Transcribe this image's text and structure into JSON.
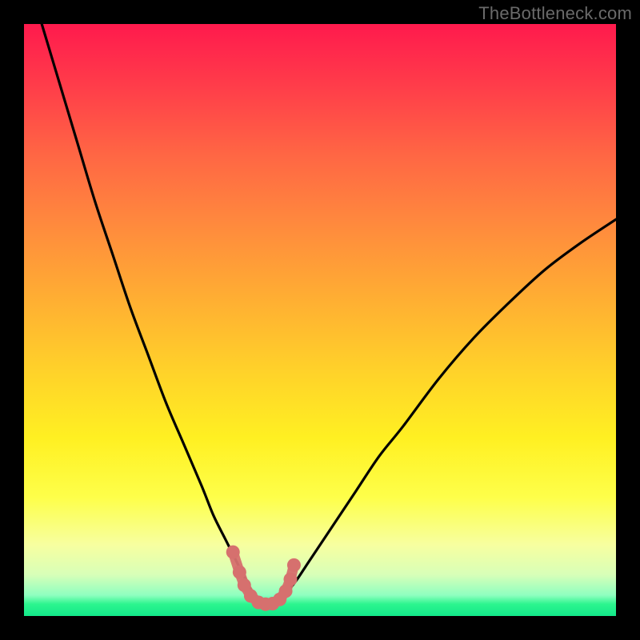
{
  "watermark": "TheBottleneck.com",
  "colors": {
    "background": "#000000",
    "curve": "#000000",
    "markers": "#d6706e"
  },
  "chart_data": {
    "type": "line",
    "title": "",
    "xlabel": "",
    "ylabel": "",
    "xlim": [
      0,
      100
    ],
    "ylim": [
      0,
      100
    ],
    "series": [
      {
        "name": "bottleneck-curve",
        "x": [
          3,
          6,
          9,
          12,
          15,
          18,
          21,
          24,
          27,
          30,
          32,
          34,
          36,
          37,
          38,
          39,
          40,
          41,
          42,
          43,
          44,
          46,
          48,
          52,
          56,
          60,
          64,
          70,
          76,
          82,
          88,
          94,
          100
        ],
        "y": [
          100,
          90,
          80,
          70,
          61,
          52,
          44,
          36,
          29,
          22,
          17,
          13,
          9,
          7,
          5,
          3.5,
          2.5,
          2,
          2,
          2.5,
          3.5,
          6,
          9,
          15,
          21,
          27,
          32,
          40,
          47,
          53,
          58.5,
          63,
          67
        ]
      }
    ],
    "markers": {
      "name": "highlighted-points",
      "x": [
        35.3,
        36.4,
        37.2,
        38.3,
        39.6,
        40.8,
        42.0,
        43.2,
        44.2,
        45.0,
        45.6
      ],
      "y": [
        10.8,
        7.4,
        5.2,
        3.4,
        2.3,
        2.0,
        2.1,
        2.8,
        4.2,
        6.2,
        8.6
      ]
    }
  }
}
